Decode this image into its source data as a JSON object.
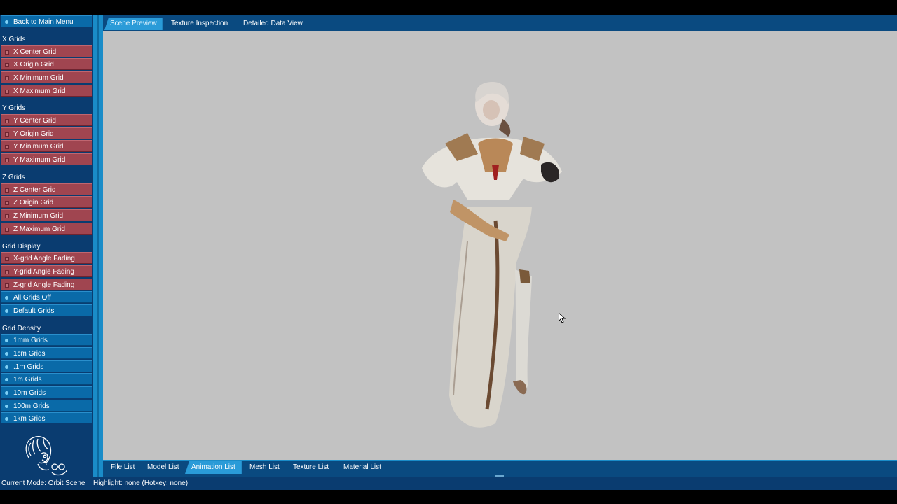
{
  "sidebar": {
    "back": "Back to Main Menu",
    "sections": {
      "x": {
        "title": "X Grids",
        "items": [
          "X Center Grid",
          "X Origin Grid",
          "X Minimum Grid",
          "X Maximum Grid"
        ]
      },
      "y": {
        "title": "Y Grids",
        "items": [
          "Y Center Grid",
          "Y Origin Grid",
          "Y Minimum Grid",
          "Y Maximum Grid"
        ]
      },
      "z": {
        "title": "Z Grids",
        "items": [
          "Z Center Grid",
          "Z Origin Grid",
          "Z Minimum Grid",
          "Z Maximum Grid"
        ]
      },
      "display": {
        "title": "Grid Display",
        "items": [
          "X-grid Angle Fading",
          "Y-grid Angle Fading",
          "Z-grid Angle Fading",
          "All Grids Off",
          "Default Grids"
        ]
      },
      "density": {
        "title": "Grid Density",
        "items": [
          "1mm Grids",
          "1cm Grids",
          ".1m Grids",
          "1m Grids",
          "10m Grids",
          "100m Grids",
          "1km Grids"
        ]
      }
    }
  },
  "top_tabs": [
    "Scene Preview",
    "Texture Inspection",
    "Detailed Data View"
  ],
  "bottom_tabs": [
    "File List",
    "Model List",
    "Animation List",
    "Mesh List",
    "Texture List",
    "Material List"
  ],
  "status": {
    "mode": "Current Mode: Orbit Scene",
    "highlight": "Highlight: none (Hotkey: none)"
  },
  "colors": {
    "sidebar_bg": "#0a3c70",
    "blue_item": "#0a6aa8",
    "red_item": "#a04550",
    "accent": "#2a9bd8",
    "viewport_bg": "#c2c2c2"
  },
  "icons": [
    "cursor-arrow-icon",
    "app-logo-icon"
  ]
}
